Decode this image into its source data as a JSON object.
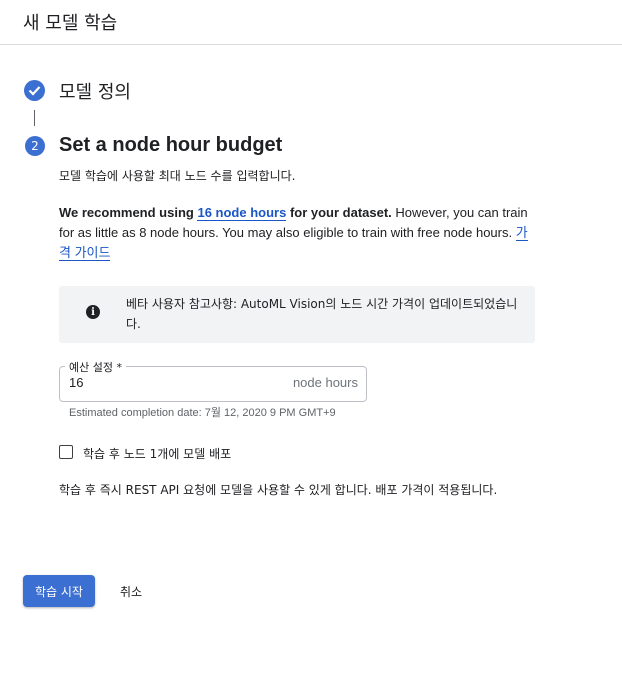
{
  "header": {
    "title": "새 모델 학습"
  },
  "step1": {
    "label": "모델 정의"
  },
  "step2": {
    "number": "2",
    "label": "Set a node hour budget",
    "description": "모델 학습에 사용할 최대 노드 수를 입력합니다."
  },
  "recommendation": {
    "prefix_bold": "We recommend using ",
    "link_text": "16 node hours",
    "suffix_bold": " for your dataset.",
    "body": " However, you can train for as little as 8 node hours. You may also eligible to train with free node hours. ",
    "pricing_link": "가격 가이드"
  },
  "notice": {
    "icon": "info-icon",
    "text": "베타 사용자 참고사항: AutoML Vision의 노드 시간 가격이 업데이트되었습니다."
  },
  "budget_field": {
    "label": "예산 설정 *",
    "value": "16",
    "suffix": "node hours",
    "hint": "Estimated completion date: 7월 12, 2020 9 PM GMT+9"
  },
  "deploy_checkbox": {
    "label": "학습 후 노드 1개에 모델 배포",
    "checked": false
  },
  "footnote": "학습 후 즉시 REST API 요청에 모델을 사용할 수 있게 합니다. 배포 가격이 적용됩니다.",
  "actions": {
    "start_label": "학습 시작",
    "cancel_label": "취소"
  },
  "colors": {
    "accent": "#3b6fd1",
    "link": "#1a56c6"
  }
}
